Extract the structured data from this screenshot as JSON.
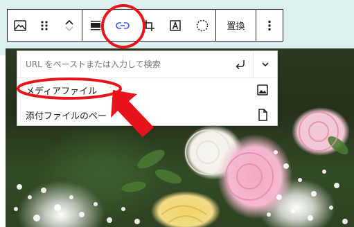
{
  "toolbar": {
    "replace_label": "置換",
    "accent_color": "#3858e9"
  },
  "link_popover": {
    "search_placeholder": "URL をペーストまたは入力して検索",
    "suggestions": [
      {
        "label": "メディアファイル",
        "icon": "image-icon"
      },
      {
        "label": "添付ファイルのペー",
        "icon": "page-icon"
      }
    ]
  },
  "annotation": {
    "color": "#e8141b"
  }
}
